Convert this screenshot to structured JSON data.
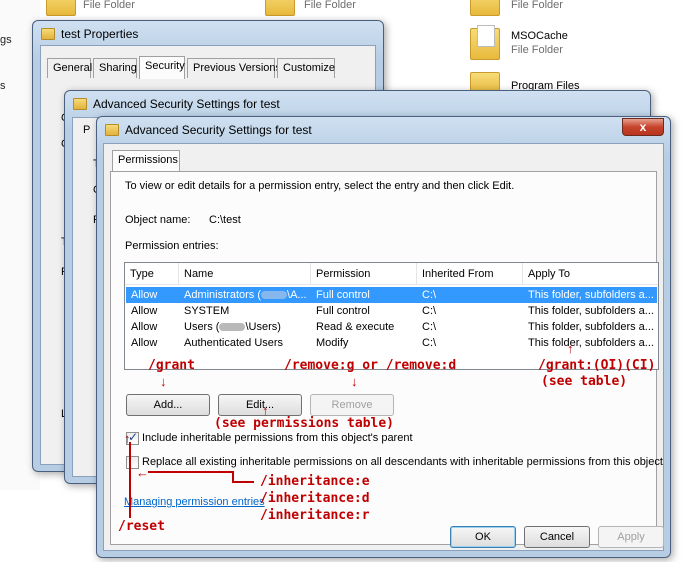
{
  "background": {
    "left_texts": [
      "gs",
      "s"
    ],
    "folders": [
      {
        "name": "File Folder",
        "sub": ""
      },
      {
        "name": "File Folder",
        "sub": ""
      },
      {
        "name": "File Folder",
        "sub": ""
      },
      {
        "name": "MSOCache",
        "sub": "File Folder"
      },
      {
        "name": "Program Files",
        "sub": ""
      }
    ]
  },
  "properties_window": {
    "title": "test Properties",
    "tabs": [
      "General",
      "Sharing",
      "Security",
      "Previous Versions",
      "Customize"
    ],
    "active_tab": "Security",
    "left_fragments": [
      "O",
      "G",
      "T",
      "P",
      "L",
      "P",
      "P",
      "P",
      "T",
      "F"
    ]
  },
  "advanced_back_window": {
    "title": "Advanced Security Settings for test",
    "left_fragments": [
      "P",
      "T",
      "O",
      "P"
    ]
  },
  "dialog": {
    "title": "Advanced Security Settings for test",
    "close_label": "x",
    "tab": "Permissions",
    "instructions": "To view or edit details for a permission entry, select the entry and then click Edit.",
    "object_name_label": "Object name:",
    "object_name_value": "C:\\test",
    "entries_label": "Permission entries:",
    "columns": [
      "Type",
      "Name",
      "Permission",
      "Inherited From",
      "Apply To"
    ],
    "rows": [
      {
        "type": "Allow",
        "name_a": "Administrators (",
        "name_b": "\\A...",
        "permission": "Full control",
        "inherited": "C:\\",
        "apply": "This folder, subfolders a...",
        "selected": true
      },
      {
        "type": "Allow",
        "name_a": "SYSTEM",
        "name_b": "",
        "permission": "Full control",
        "inherited": "C:\\",
        "apply": "This folder, subfolders a...",
        "selected": false
      },
      {
        "type": "Allow",
        "name_a": "Users (",
        "name_b": "\\Users)",
        "permission": "Read & execute",
        "inherited": "C:\\",
        "apply": "This folder, subfolders a...",
        "selected": false
      },
      {
        "type": "Allow",
        "name_a": "Authenticated Users",
        "name_b": "",
        "permission": "Modify",
        "inherited": "C:\\",
        "apply": "This folder, subfolders a...",
        "selected": false
      }
    ],
    "buttons": {
      "add": "Add...",
      "edit": "Edit...",
      "remove": "Remove"
    },
    "include_inheritable": "Include inheritable permissions from this object's parent",
    "include_checked": true,
    "replace_all": "Replace all existing inheritable permissions on all descendants with inheritable permissions from this object",
    "replace_checked": false,
    "link": "Managing permission entries",
    "footer": {
      "ok": "OK",
      "cancel": "Cancel",
      "apply": "Apply"
    }
  },
  "annotations": {
    "grant": "/grant",
    "remove": "/remove:g or /remove:d",
    "grant_oi_ci": "/grant:(OI)(CI)",
    "see_table": "(see table)",
    "see_permissions_table": "(see permissions table)",
    "inheritance_e": "/inheritance:e",
    "inheritance_d": "/inheritance:d",
    "inheritance_r": "/inheritance:r",
    "reset": "/reset"
  },
  "colors": {
    "annotation": "#c00000",
    "selection": "#3399ff",
    "link": "#0066cc"
  }
}
